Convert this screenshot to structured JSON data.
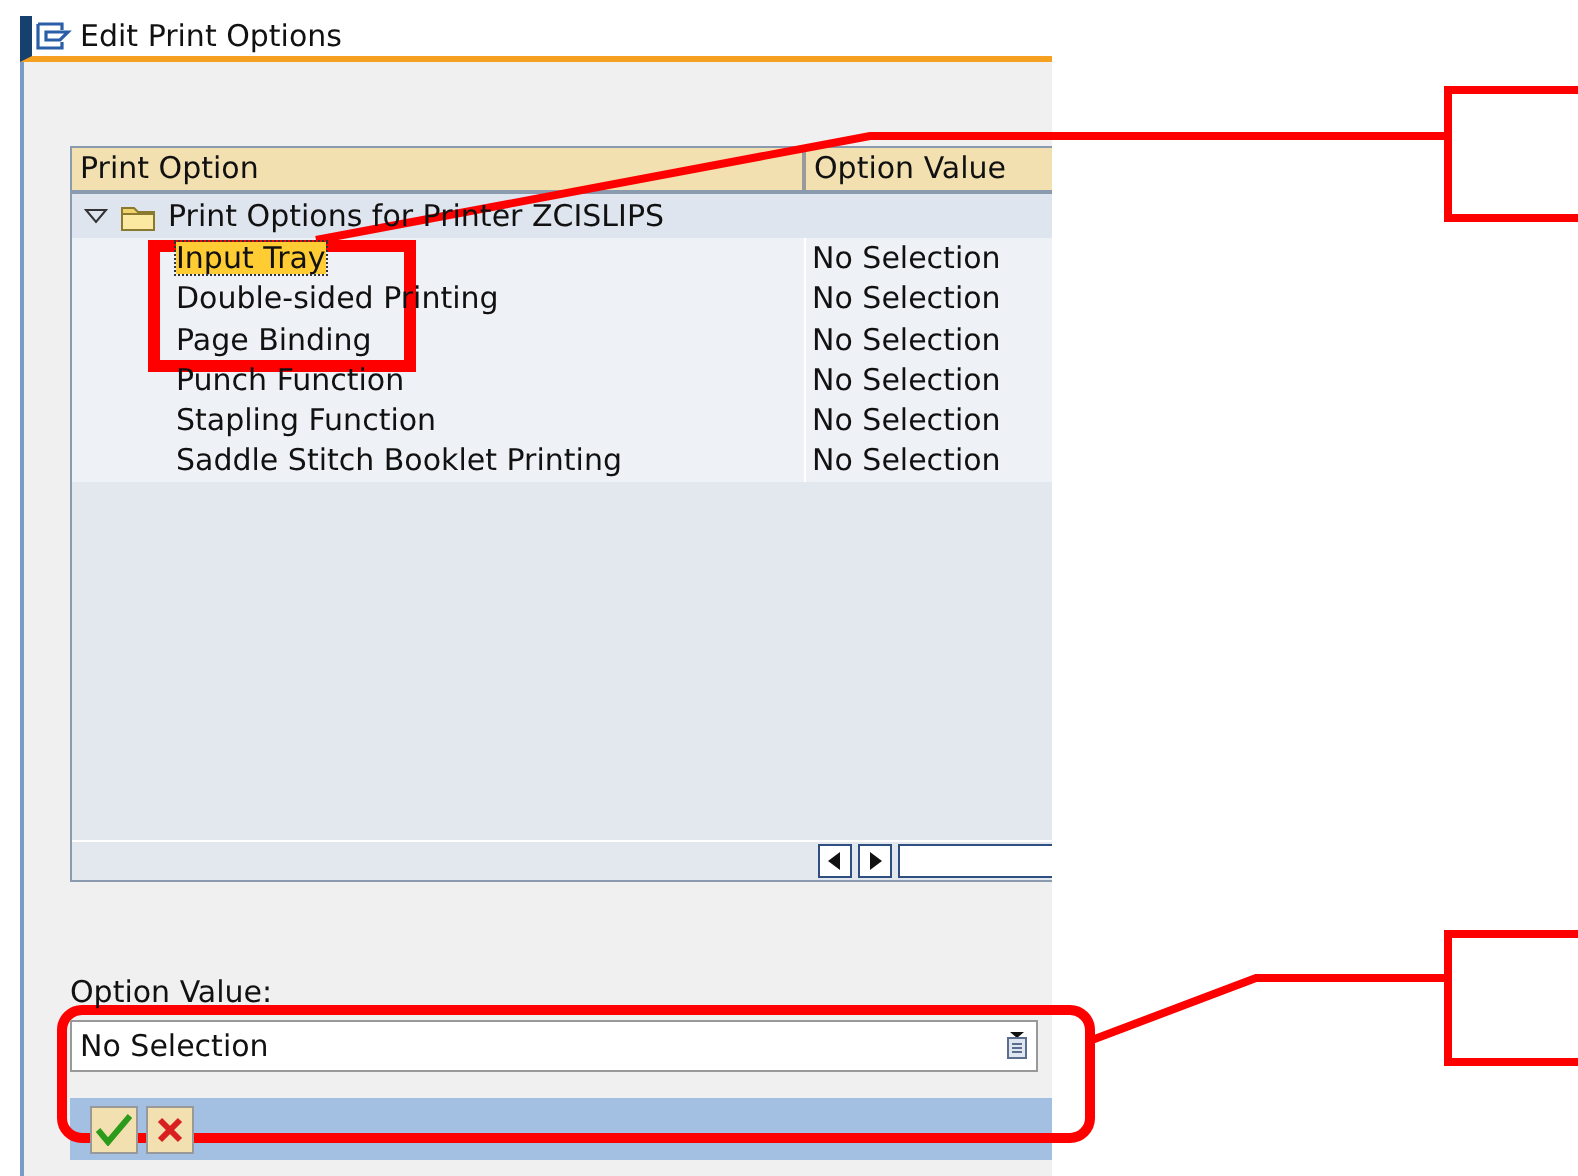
{
  "window": {
    "title": "Edit Print Options"
  },
  "table": {
    "columns": [
      "Print Option",
      "Option Value"
    ],
    "group": {
      "label": "Print Options for Printer ZCISLIPS",
      "expanded": true
    },
    "rows": [
      {
        "option": "Input Tray",
        "value": "No Selection",
        "selected": true
      },
      {
        "option": "Double-sided Printing",
        "value": "No Selection",
        "selected": false
      },
      {
        "option": "Page Binding",
        "value": "No Selection",
        "selected": false
      },
      {
        "option": "Punch Function",
        "value": "No Selection",
        "selected": false
      },
      {
        "option": "Stapling Function",
        "value": "No Selection",
        "selected": false
      },
      {
        "option": "Saddle Stitch Booklet Printing",
        "value": "No Selection",
        "selected": false
      }
    ]
  },
  "option_value": {
    "label": "Option Value:",
    "value": "No Selection"
  }
}
